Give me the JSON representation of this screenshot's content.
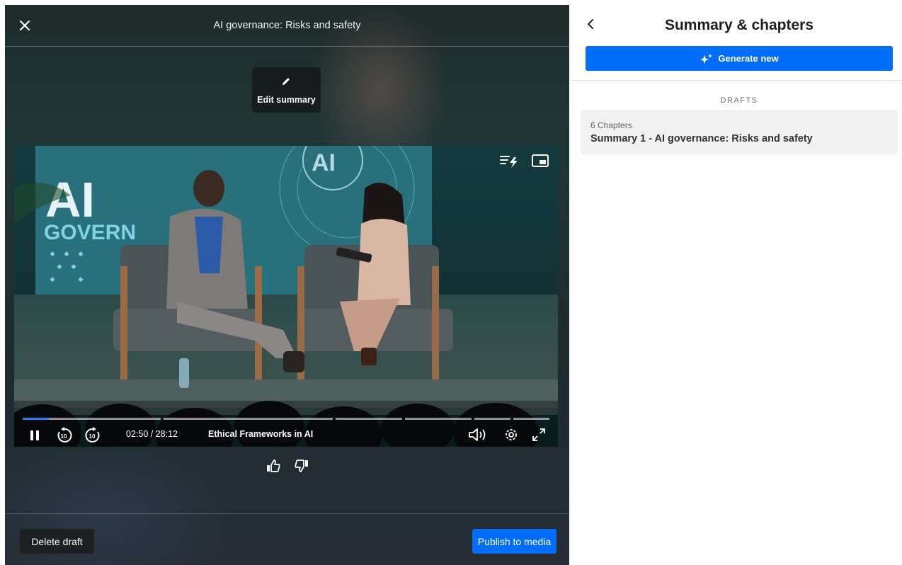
{
  "player": {
    "title": "AI governance: Risks and safety",
    "edit_summary_label": "Edit summary",
    "time": "02:50 / 28:12",
    "chapter": "Ethical Frameworks in AI",
    "progress_fraction": 0.1,
    "chapter_segment_count": 6
  },
  "footer": {
    "delete_label": "Delete draft",
    "publish_label": "Publish to media"
  },
  "panel": {
    "title": "Summary & chapters",
    "generate_label": "Generate new",
    "drafts_heading": "DRAFTS",
    "drafts": [
      {
        "meta": "6 Chapters",
        "name": "Summary 1 - AI governance: Risks and safety"
      }
    ]
  },
  "colors": {
    "accent": "#006efa",
    "progress": "#2f7bff",
    "delete_button": "#1d1f20"
  },
  "icons": [
    "close-icon",
    "pencil-icon",
    "chapters-icon",
    "picture-in-picture-icon",
    "pause-icon",
    "rewind-10-icon",
    "forward-10-icon",
    "volume-icon",
    "settings-icon",
    "fullscreen-icon",
    "thumbs-up-icon",
    "thumbs-down-icon",
    "chevron-left-icon",
    "sparkle-icon"
  ]
}
